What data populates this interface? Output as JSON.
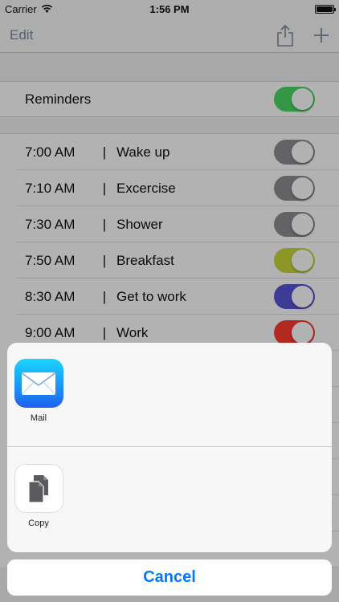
{
  "status_bar": {
    "carrier": "Carrier",
    "time": "1:56 PM"
  },
  "nav": {
    "edit_label": "Edit",
    "share_icon": "share-icon",
    "add_icon": "plus-icon"
  },
  "reminders": {
    "label": "Reminders",
    "enabled": true,
    "color": "#4cd964"
  },
  "alarms": [
    {
      "time": "7:00 AM",
      "sep": "|",
      "name": "Wake up",
      "color": "#8e8e93"
    },
    {
      "time": "7:10 AM",
      "sep": "|",
      "name": "Excercise",
      "color": "#8e8e93"
    },
    {
      "time": "7:30 AM",
      "sep": "|",
      "name": "Shower",
      "color": "#8e8e93"
    },
    {
      "time": "7:50 AM",
      "sep": "|",
      "name": "Breakfast",
      "color": "#c9d93a"
    },
    {
      "time": "8:30 AM",
      "sep": "|",
      "name": "Get to work",
      "color": "#5856d6"
    },
    {
      "time": "9:00 AM",
      "sep": "|",
      "name": "Work",
      "color": "#ff3b30"
    }
  ],
  "share_sheet": {
    "share_activities": [
      {
        "label": "Mail",
        "icon": "mail-icon"
      }
    ],
    "action_activities": [
      {
        "label": "Copy",
        "icon": "copy-icon"
      }
    ],
    "cancel_label": "Cancel"
  }
}
